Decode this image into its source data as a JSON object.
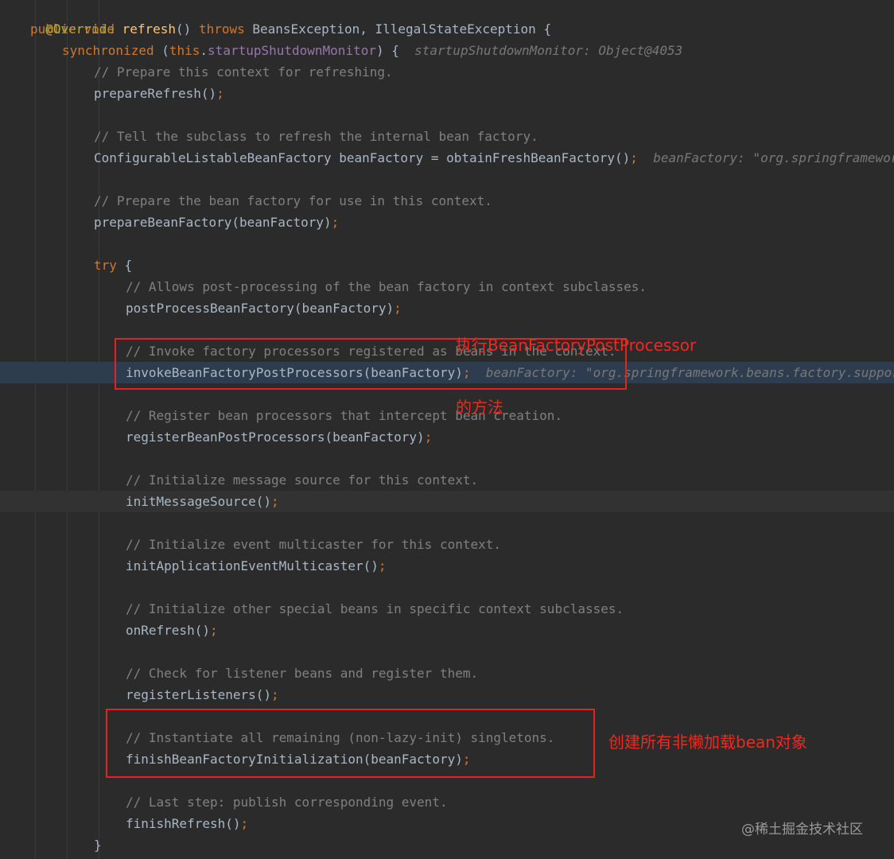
{
  "code": {
    "override": "@Override",
    "sig_public": "public",
    "sig_void": "void",
    "sig_name": "refresh",
    "sig_paren": "()",
    "sig_throws": "throws",
    "sig_rest": "BeansException, IllegalStateException {",
    "sync_kw": "synchronized",
    "sync_open": "(",
    "sync_this": "this",
    "sync_dot": ".",
    "sync_field": "startupShutdownMonitor",
    "sync_close": ") {",
    "sync_hint": "startupShutdownMonitor: Object@4053",
    "c1": "// Prepare this context for refreshing.",
    "l1": "prepareRefresh()",
    "c2": "// Tell the subclass to refresh the internal bean factory.",
    "l2": "ConfigurableListableBeanFactory beanFactory = obtainFreshBeanFactory()",
    "l2_hint": "beanFactory: \"org.springframework",
    "c3": "// Prepare the bean factory for use in this context.",
    "l3": "prepareBeanFactory(beanFactory)",
    "try_kw": "try",
    "try_brace": " {",
    "c4": "// Allows post-processing of the bean factory in context subclasses.",
    "l4": "postProcessBeanFactory(beanFactory)",
    "c5": "// Invoke factory processors registered as beans in the context.",
    "l5": "invokeBeanFactoryPostProcessors(beanFactory)",
    "l5_hint": "beanFactory: \"org.springframework.beans.factory.support",
    "c6": "// Register bean processors that intercept bean creation.",
    "l6": "registerBeanPostProcessors(beanFactory)",
    "c7": "// Initialize message source for this context.",
    "l7": "initMessageSource()",
    "c8": "// Initialize event multicaster for this context.",
    "l8": "initApplicationEventMulticaster()",
    "c9": "// Initialize other special beans in specific context subclasses.",
    "l9": "onRefresh()",
    "c10": "// Check for listener beans and register them.",
    "l10": "registerListeners()",
    "c11": "// Instantiate all remaining (non-lazy-init) singletons.",
    "l11": "finishBeanFactoryInitialization(beanFactory)",
    "c12": "// Last step: publish corresponding event.",
    "l12": "finishRefresh()",
    "semi": ";",
    "close_brace": "}"
  },
  "annotations": {
    "note1_line1": "执行BeanFactoryPostProcessor",
    "note1_line2": "的方法",
    "note2": "创建所有非懒加载bean对象"
  },
  "watermark": "@稀土掘金技术社区",
  "colors": {
    "background": "#2b2b2b",
    "keyword": "#cc7832",
    "annotation": "#bbb529",
    "method_decl": "#ffc66d",
    "field": "#9876aa",
    "comment": "#808080",
    "highlight_box": "#e8211f"
  }
}
